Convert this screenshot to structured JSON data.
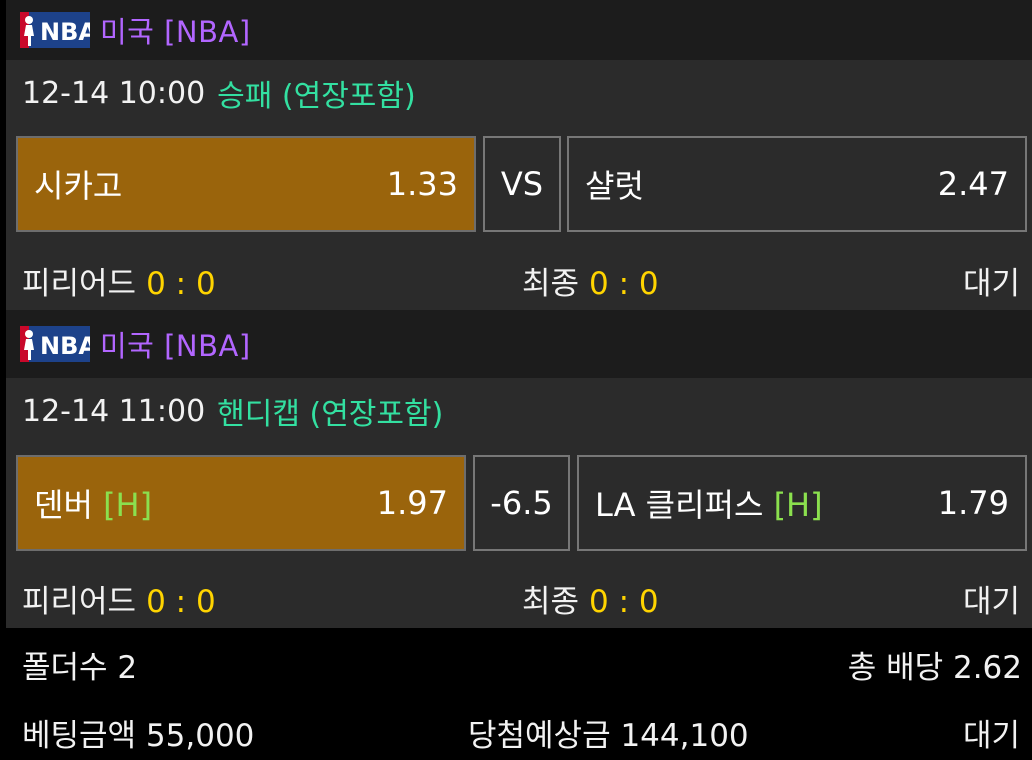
{
  "matches": [
    {
      "league": "미국 [NBA]",
      "datetime": "12-14 10:00",
      "market": "승패 (연장포함)",
      "home": {
        "name": "시카고",
        "tag": "",
        "odd": "1.33",
        "selected": true
      },
      "middle": "VS",
      "away": {
        "name": "샬럿",
        "tag": "",
        "odd": "2.47",
        "selected": false
      },
      "period_label": "피리어드",
      "period_score": "0 : 0",
      "final_label": "최종",
      "final_score": "0 : 0",
      "status": "대기"
    },
    {
      "league": "미국 [NBA]",
      "datetime": "12-14 11:00",
      "market": "핸디캡 (연장포함)",
      "home": {
        "name": "덴버",
        "tag": "[H]",
        "odd": "1.97",
        "selected": true
      },
      "middle": "-6.5",
      "away": {
        "name": "LA 클리퍼스",
        "tag": "[H]",
        "odd": "1.79",
        "selected": false
      },
      "period_label": "피리어드",
      "period_score": "0 : 0",
      "final_label": "최종",
      "final_score": "0 : 0",
      "status": "대기"
    }
  ],
  "summary": {
    "folder_label": "폴더수 2",
    "total_odds_label": "총 배당 2.62",
    "bet_amount_label": "베팅금액 55,000",
    "expected_win_label": "당첨예상금 144,100",
    "status": "대기"
  },
  "colors": {
    "league": "#b266ff",
    "market": "#33e0a1",
    "score": "#ffd400",
    "handicap_tag": "#8be04e",
    "selected_bg": "#9a640c"
  },
  "icons": {
    "league_logo": "nba-logo-icon"
  }
}
